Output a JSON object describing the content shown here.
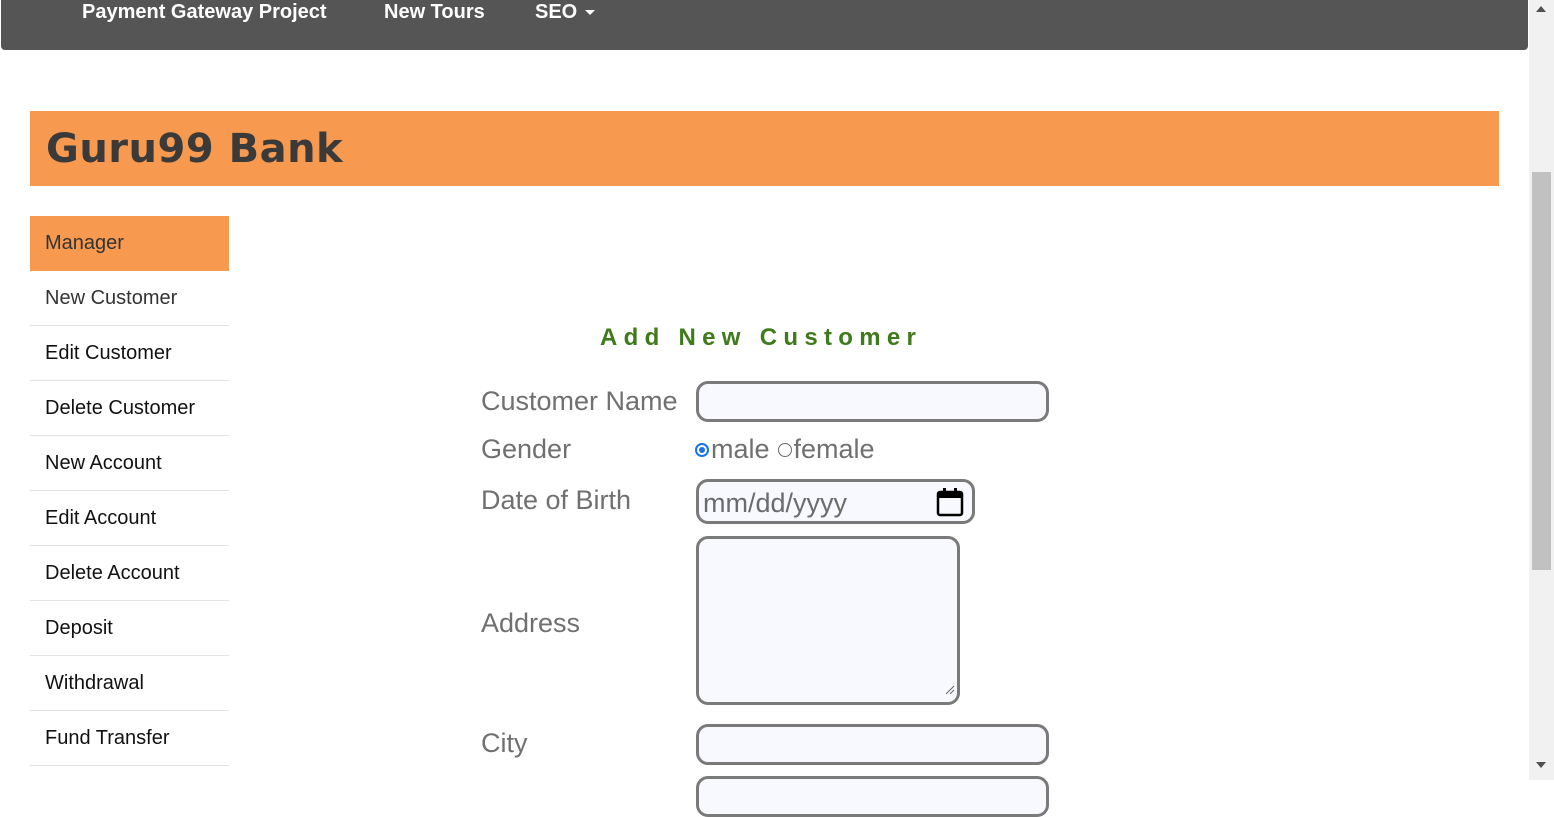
{
  "topnav": {
    "items": [
      "Payment Gateway Project",
      "New Tours",
      "SEO"
    ]
  },
  "banner": {
    "brand": "Guru99 Bank"
  },
  "sidebar": {
    "items": [
      {
        "label": "Manager"
      },
      {
        "label": "New Customer"
      },
      {
        "label": "Edit Customer"
      },
      {
        "label": "Delete Customer"
      },
      {
        "label": "New Account"
      },
      {
        "label": "Edit Account"
      },
      {
        "label": "Delete Account"
      },
      {
        "label": "Deposit"
      },
      {
        "label": "Withdrawal"
      },
      {
        "label": "Fund Transfer"
      }
    ]
  },
  "form": {
    "title": "Add New Customer",
    "customer_name_label": "Customer Name",
    "gender_label": "Gender",
    "gender_male": "male",
    "gender_female": "female",
    "gender_selected": "male",
    "dob_label": "Date of Birth",
    "dob_placeholder": "mm/dd/yyyy",
    "address_label": "Address",
    "city_label": "City"
  },
  "colors": {
    "accent": "#f79a50",
    "nav_bg": "#555555",
    "title_green": "#3f7a1b"
  }
}
